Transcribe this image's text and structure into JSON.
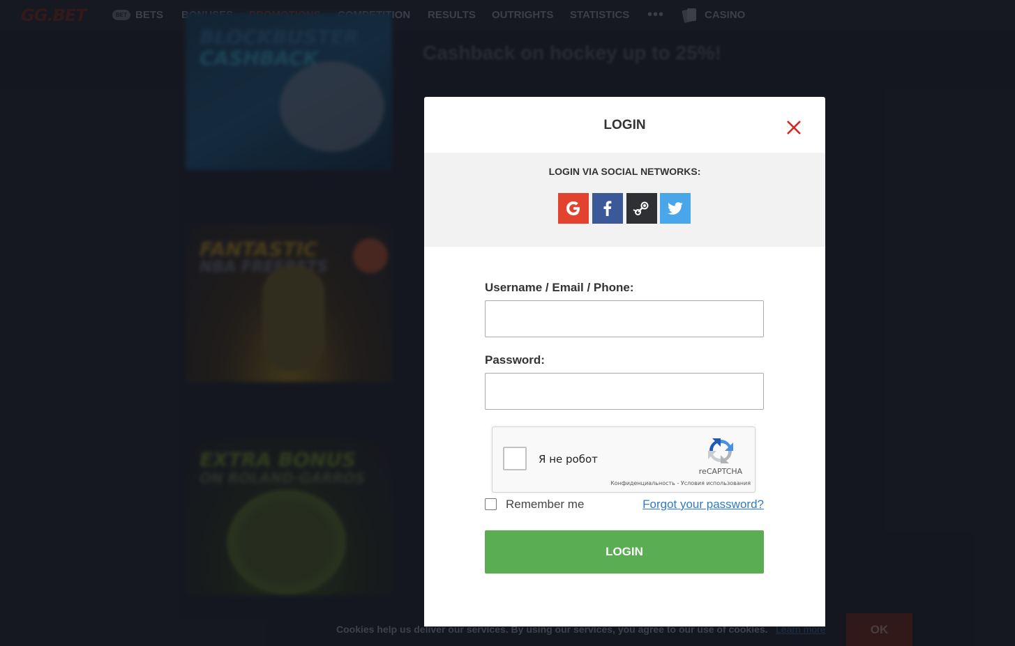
{
  "nav": {
    "logo": "GG.BET",
    "bet_badge": "BET",
    "items": [
      "BETS",
      "BONUSES",
      "PROMOTIONS",
      "COMPETITION",
      "RESULTS",
      "OUTRIGHTS",
      "STATISTICS"
    ],
    "more": "•••",
    "casino": "CASINO",
    "active_item": "PROMOTIONS"
  },
  "promos": [
    {
      "text_line1": "BLOCKBUSTER",
      "text_line2": "CASHBACK",
      "title": "Cashback on hockey up to 25%!"
    },
    {
      "text_line1": "FANTASTIC",
      "text_line2": "NBA FREEBETS"
    },
    {
      "text_line1": "EXTRA BONUS",
      "text_line2": "ON ROLAND-GARROS"
    }
  ],
  "cookie": {
    "text": "Cookies help us deliver our services. By using our services, you agree to our use of cookies.",
    "learn_more": "Learn more",
    "ok": "OK"
  },
  "modal": {
    "title": "LOGIN",
    "social_title": "LOGIN VIA SOCIAL NETWORKS:",
    "social": [
      {
        "name": "google",
        "color": "#e3422f",
        "icon": "google-icon"
      },
      {
        "name": "facebook",
        "color": "#3b5998",
        "icon": "facebook-icon"
      },
      {
        "name": "steam",
        "color": "#2f3033",
        "icon": "steam-icon"
      },
      {
        "name": "twitter",
        "color": "#4aa6ea",
        "icon": "twitter-icon"
      }
    ],
    "username_label": "Username / Email / Phone:",
    "username_value": "",
    "password_label": "Password:",
    "password_value": "",
    "recaptcha": {
      "label": "Я не робот",
      "brand": "reCAPTCHA",
      "privacy": "Конфиденциальность",
      "separator": " - ",
      "terms": "Условия использования"
    },
    "remember_label": "Remember me",
    "forgot_label": "Forgot your password?",
    "login_button": "LOGIN"
  },
  "colors": {
    "accent_red": "#d9261c",
    "login_green": "#5aad52",
    "link_blue": "#2d7cc4"
  }
}
